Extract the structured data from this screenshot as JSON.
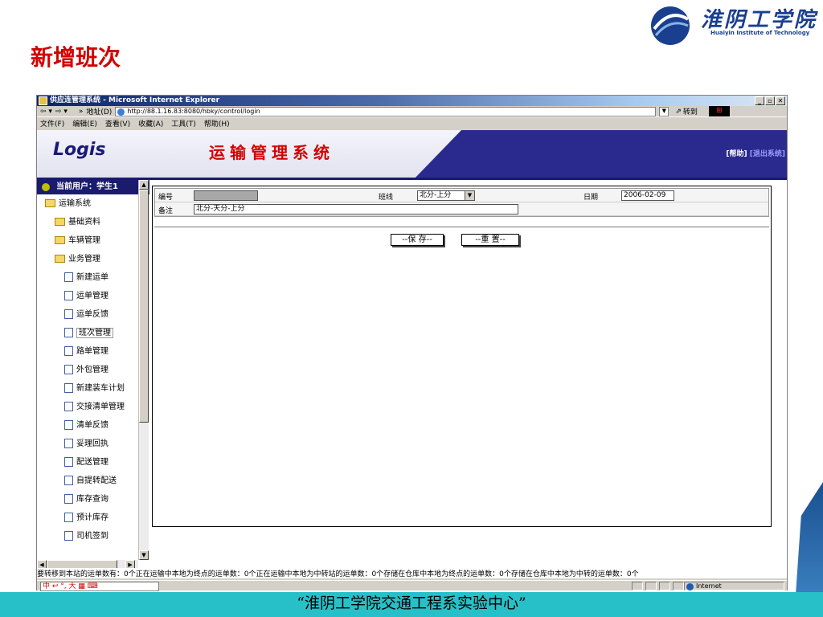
{
  "slide": {
    "title": "新增班次",
    "footer": "“淮阴工学院交通工程系实验中心”",
    "logo_text": "淮阴工学院",
    "logo_sub": "Huaiyin Institute of Technology"
  },
  "browser": {
    "title": "供应连管理系统 - Microsoft Internet Explorer",
    "address_label": "地址(D)",
    "url": "http://88.1.16.83:8080/hbky/control/login",
    "go_label": "转到",
    "menu": [
      "文件(F)",
      "编辑(E)",
      "查看(V)",
      "收藏(A)",
      "工具(T)",
      "帮助(H)"
    ],
    "status_zone": "Internet"
  },
  "app": {
    "brand": "Logis",
    "system_title": "运输管理系统",
    "help_link": "[帮助]",
    "exit_link": "[退出系统]"
  },
  "sidebar": {
    "user": "当前用户：学生1",
    "items": [
      {
        "label": "运输系统",
        "type": "folder",
        "level": 0
      },
      {
        "label": "基础资料",
        "type": "folder",
        "level": 1
      },
      {
        "label": "车辆管理",
        "type": "folder",
        "level": 1
      },
      {
        "label": "业务管理",
        "type": "folder",
        "level": 1
      },
      {
        "label": "新建运单",
        "type": "doc",
        "level": 2
      },
      {
        "label": "运单管理",
        "type": "doc",
        "level": 2
      },
      {
        "label": "运单反馈",
        "type": "doc",
        "level": 2
      },
      {
        "label": "班次管理",
        "type": "doc",
        "level": 2,
        "active": true
      },
      {
        "label": "路单管理",
        "type": "doc",
        "level": 2
      },
      {
        "label": "外包管理",
        "type": "doc",
        "level": 2
      },
      {
        "label": "新建装车计划",
        "type": "doc",
        "level": 2
      },
      {
        "label": "交接清单管理",
        "type": "doc",
        "level": 2
      },
      {
        "label": "清单反馈",
        "type": "doc",
        "level": 2
      },
      {
        "label": "妥理回执",
        "type": "doc",
        "level": 2
      },
      {
        "label": "配送管理",
        "type": "doc",
        "level": 2
      },
      {
        "label": "自提转配送",
        "type": "doc",
        "level": 2
      },
      {
        "label": "库存查询",
        "type": "doc",
        "level": 2
      },
      {
        "label": "预计库存",
        "type": "doc",
        "level": 2
      },
      {
        "label": "司机签到",
        "type": "doc",
        "level": 2
      }
    ]
  },
  "form": {
    "code_label": "编号",
    "code_value": "",
    "line_label": "班线",
    "line_value": "北分-上分",
    "date_label": "日期",
    "date_value": "2006-02-09",
    "remark_label": "备注",
    "remark_value": "北分-天分-上分",
    "save_label": "--保 存--",
    "reset_label": "--重 置--"
  },
  "status_line": "要转移到本站的运单数有：0个正在运输中本地为终点的运单数：0个正在运输中本地为中转站的运单数：0个存储在仓库中本地为终点的运单数：0个存储在仓库中本地为中转的运单数：0个",
  "ime": "中 ↩ °, 大 ▦ ⌨"
}
